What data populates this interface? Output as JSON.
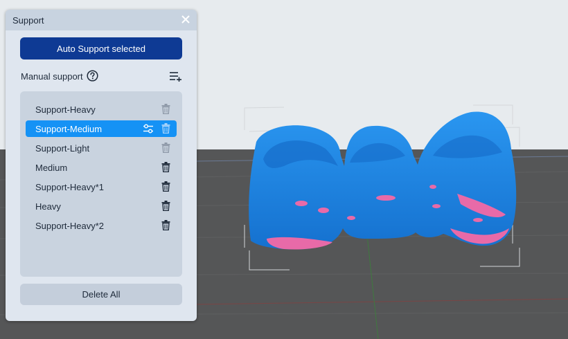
{
  "panel": {
    "title": "Support",
    "auto_button_label": "Auto Support selected",
    "manual_support_label": "Manual support",
    "delete_all_label": "Delete All",
    "items": [
      {
        "label": "Support-Heavy",
        "selected": false,
        "trash_enabled": false
      },
      {
        "label": "Support-Medium",
        "selected": true,
        "trash_enabled": false
      },
      {
        "label": "Support-Light",
        "selected": false,
        "trash_enabled": false
      },
      {
        "label": "Medium",
        "selected": false,
        "trash_enabled": true
      },
      {
        "label": "Support-Heavy*1",
        "selected": false,
        "trash_enabled": true
      },
      {
        "label": "Heavy",
        "selected": false,
        "trash_enabled": true
      },
      {
        "label": "Support-Heavy*2",
        "selected": false,
        "trash_enabled": true
      }
    ]
  },
  "icons": {
    "close": "close-icon",
    "help": "question-circle-icon",
    "add_list": "list-add-icon",
    "trash": "trash-icon",
    "adjust": "sliders-icon"
  },
  "colors": {
    "accent": "#0e3a94",
    "selected": "#1592f5",
    "model": "#1a7fe0",
    "model_highlight": "#e86aa8",
    "sky": "#e7ebee",
    "floor": "#555657"
  }
}
